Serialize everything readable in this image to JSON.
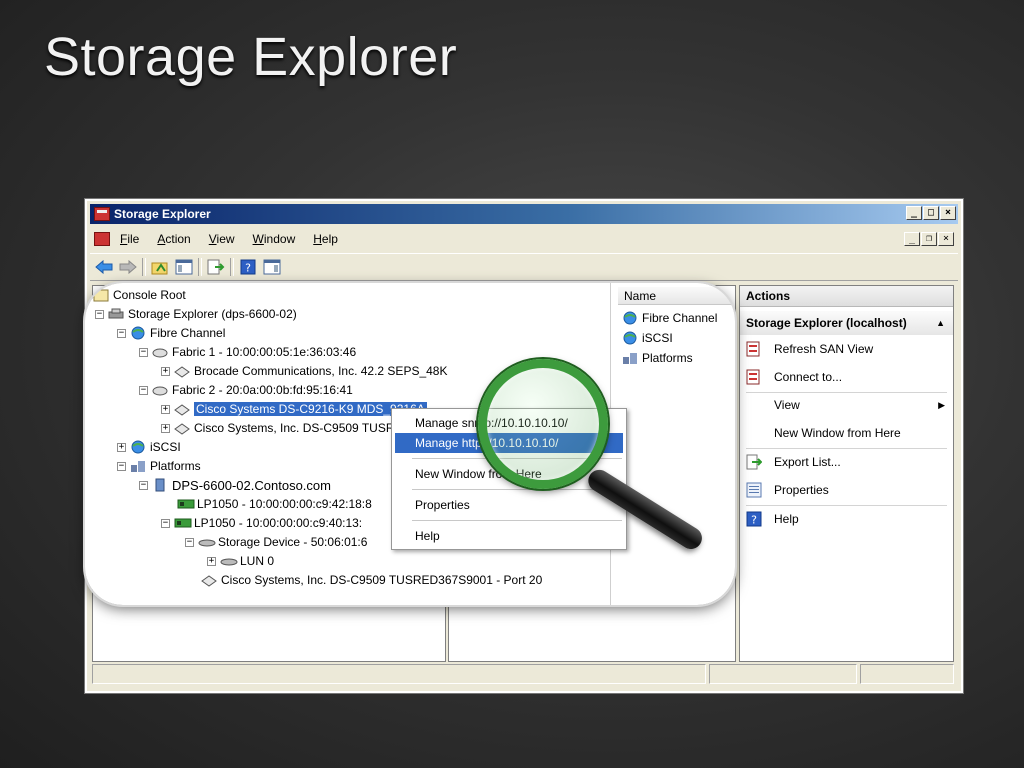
{
  "slide": {
    "title": "Storage Explorer"
  },
  "window": {
    "title": "Storage Explorer"
  },
  "menu": [
    "File",
    "Action",
    "View",
    "Window",
    "Help"
  ],
  "menu_underline": [
    "F",
    "A",
    "V",
    "W",
    "H"
  ],
  "tree": [
    {
      "label": "Console Root"
    },
    {
      "label": "Storage Explorer (dps-6600-02)"
    },
    {
      "label": "Fibre Channel"
    },
    {
      "label": "Fabric 1 - 10:00:00:05:1e:36:03:46"
    },
    {
      "label": "Brocade Communications, Inc. 42.2 SEPS_48K"
    },
    {
      "label": "Fabric 2 - 20:0a:00:0b:fd:95:16:41"
    },
    {
      "label": "Cisco Systems DS-C9216-K9 MDS_9216A"
    },
    {
      "label": "Cisco Systems, Inc. DS-C9509 TUSRED367S9001"
    },
    {
      "label": "iSCSI"
    },
    {
      "label": "Platforms"
    },
    {
      "label": "DPS-6600-02.Contoso.com"
    },
    {
      "label": "LP1050 - 10:00:00:00:c9:42:18:8"
    },
    {
      "label": "LP1050 - 10:00:00:00:c9:40:13:"
    },
    {
      "label": "Storage Device - 50:06:01:6"
    },
    {
      "label": "LUN 0"
    },
    {
      "label": "Cisco Systems, Inc. DS-C9509 TUSRED367S9001 - Port 20"
    }
  ],
  "list": {
    "header": "Name",
    "items": [
      "Fibre Channel",
      "iSCSI",
      "Platforms"
    ]
  },
  "actions": {
    "header": "Actions",
    "section": "Storage Explorer (localhost)",
    "items": [
      "Refresh SAN View",
      "Connect to...",
      "View",
      "New Window from Here",
      "Export List...",
      "Properties",
      "Help"
    ]
  },
  "context_menu": [
    "Manage snmp://10.10.10.10/",
    "Manage http://10.10.10.10/",
    "New Window from Here",
    "Properties",
    "Help"
  ],
  "colors": {
    "selection": "#316ac5",
    "lens": "#3d9b3d",
    "titlebar": "#0a246a"
  }
}
